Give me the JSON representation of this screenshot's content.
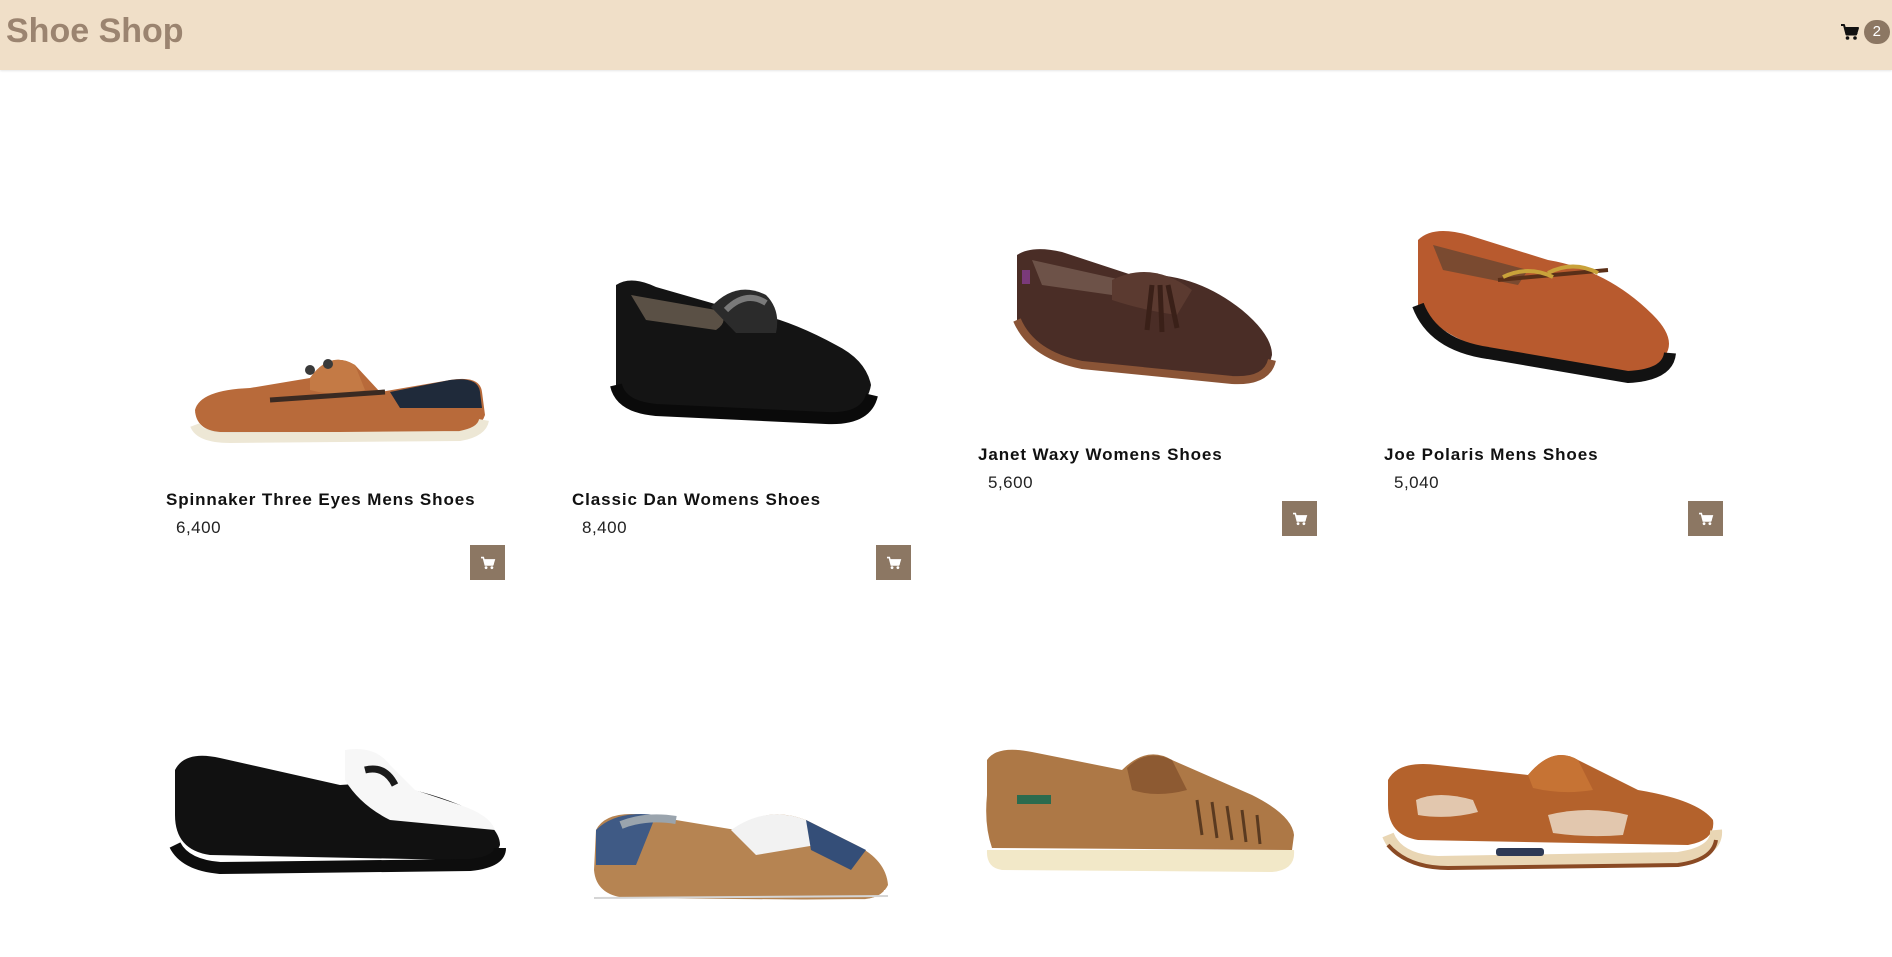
{
  "header": {
    "brand": "Shoe Shop",
    "cart_icon": "cart-icon",
    "cart_count": "2"
  },
  "colors": {
    "header_bg": "#f0dfc8",
    "brand": "#9b8470",
    "accent": "#8c7763"
  },
  "products": [
    {
      "name": "Spinnaker Three Eyes Mens Shoes",
      "price": "6,400",
      "image": "boat-shoe-tan-navy"
    },
    {
      "name": "Classic Dan Womens Shoes",
      "price": "8,400",
      "image": "penny-loafer-black"
    },
    {
      "name": "Janet Waxy Womens Shoes",
      "price": "5,600",
      "image": "tassel-loafer-brown"
    },
    {
      "name": "Joe Polaris Mens Shoes",
      "price": "5,040",
      "image": "horsebit-loafer-cognac"
    },
    {
      "image": "penny-loafer-black-white"
    },
    {
      "image": "boat-shoe-tan-blue-grey"
    },
    {
      "image": "moc-toe-tan-cream-sole"
    },
    {
      "image": "boat-shoe-brown-mesh"
    }
  ]
}
